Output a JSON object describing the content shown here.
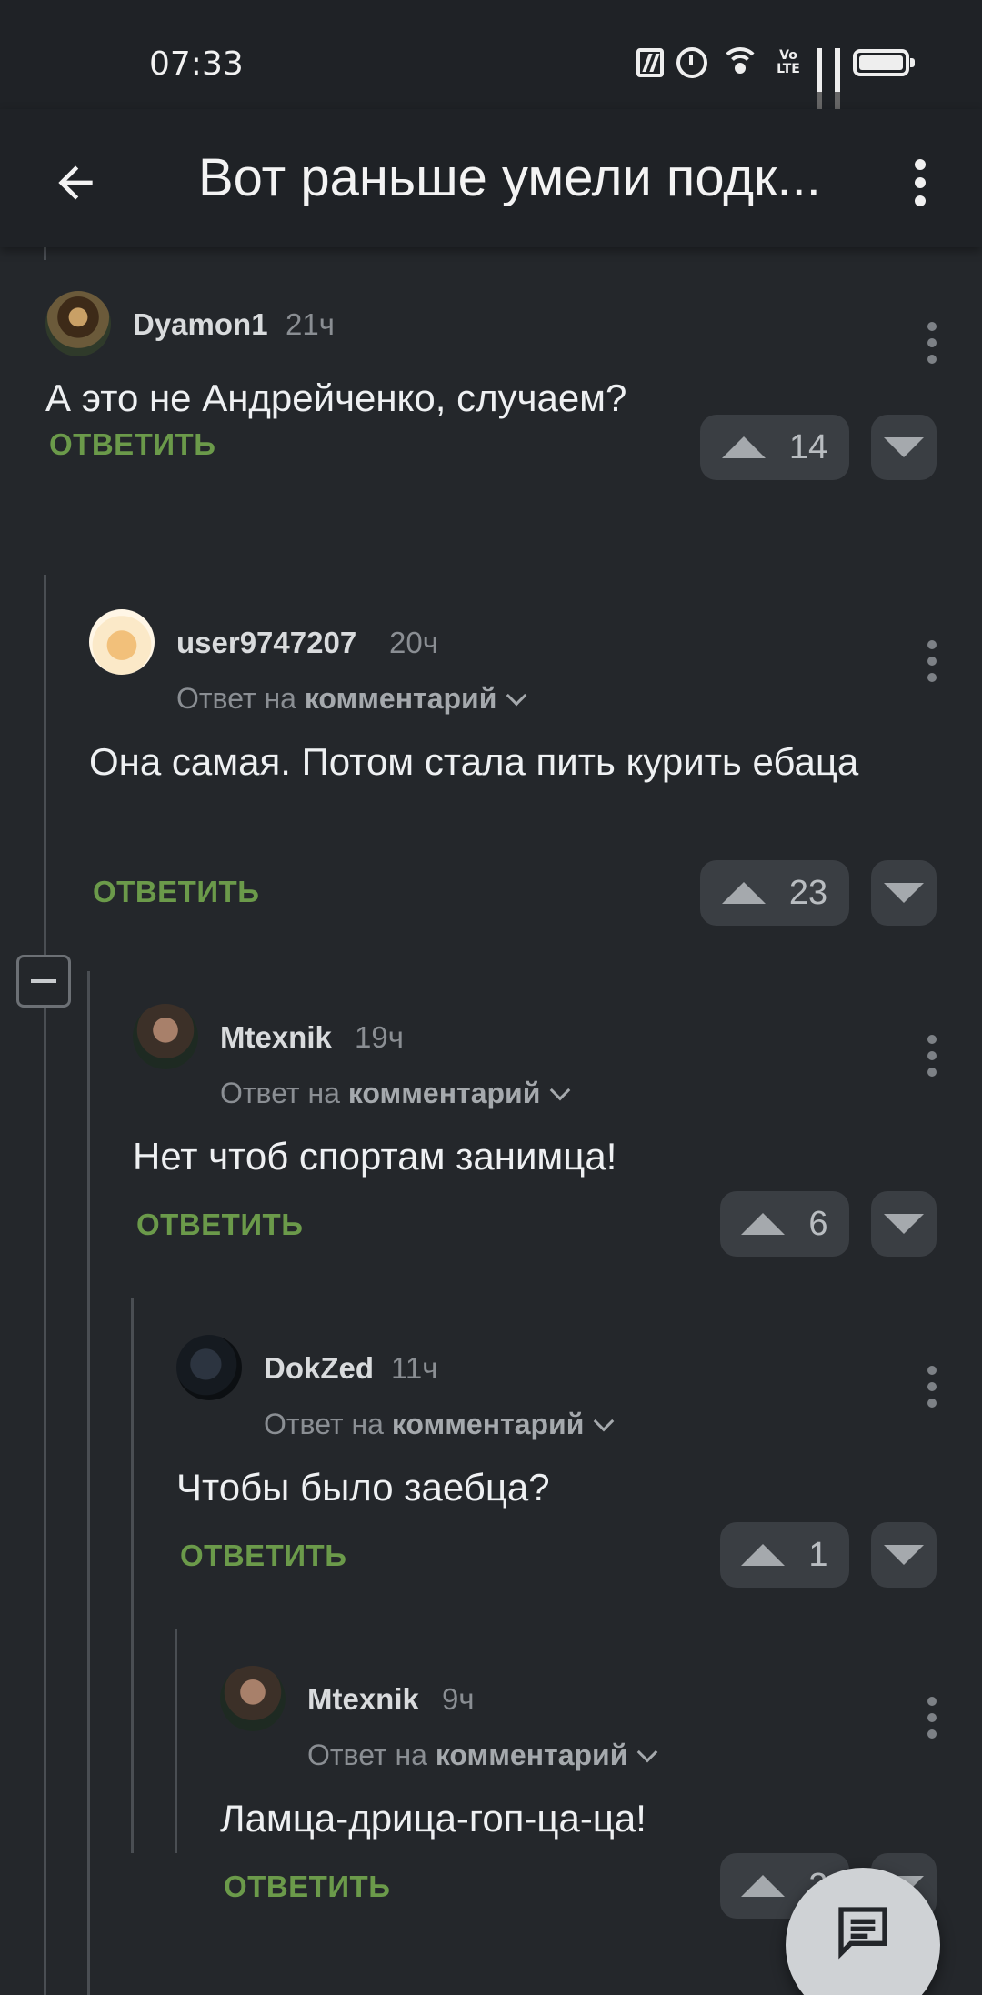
{
  "status_bar": {
    "time": "07:33"
  },
  "app_bar": {
    "title": "Вот раньше умели подк..."
  },
  "reply_label": "ОТВЕТИТЬ",
  "comments": [
    {
      "author": "Dyamon1",
      "time": "21ч",
      "reply_to_prefix": "",
      "reply_to_target": "",
      "text": "А это не Андрейченко, случаем?",
      "rating": "14",
      "avatar": "mona-lisa-avatar"
    },
    {
      "author": "user9747207",
      "time": "20ч",
      "reply_to_prefix": "Ответ на",
      "reply_to_target": "комментарий",
      "text": "Она самая. Потом стала пить курить ебаца",
      "rating": "23",
      "avatar": "chef-avatar"
    },
    {
      "author": "Mtexnik",
      "time": "19ч",
      "reply_to_prefix": "Ответ на",
      "reply_to_target": "комментарий",
      "text": "Нет чтоб спортам занимца!",
      "rating": "6",
      "avatar": "man-photo-avatar"
    },
    {
      "author": "DokZed",
      "time": "11ч",
      "reply_to_prefix": "Ответ на",
      "reply_to_target": "комментарий",
      "text": "Чтобы было заебца?",
      "rating": "1",
      "avatar": "dark-photo-avatar"
    },
    {
      "author": "Mtexnik",
      "time": "9ч",
      "reply_to_prefix": "Ответ на",
      "reply_to_target": "комментарий",
      "text": "Ламца-дрица-гоп-ца-ца!",
      "rating": "3",
      "avatar": "man-photo-avatar"
    }
  ],
  "icons": {
    "back": "arrow-left-icon",
    "more": "more-vertical-icon",
    "collapse": "minus-icon",
    "fab": "comment-icon"
  },
  "colors": {
    "background": "#24272b",
    "bar": "#1f2226",
    "reply_link": "#6b9a4a",
    "vote_button": "#3a3e43"
  }
}
